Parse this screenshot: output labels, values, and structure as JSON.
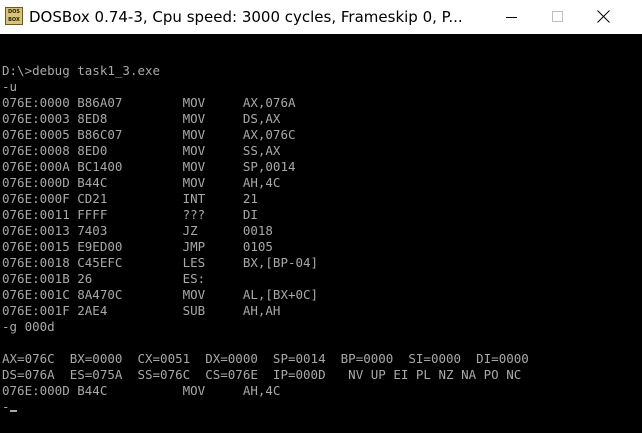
{
  "window": {
    "title": "DOSBox 0.74-3, Cpu speed:      3000 cycles, Frameskip  0, P...",
    "icon_text_top": "DOS",
    "icon_text_bottom": "BOX"
  },
  "controls": {
    "minimize": "minimize",
    "maximize": "maximize",
    "close": "close"
  },
  "colors": {
    "console_background": "#000000",
    "console_text": "#a8a8a8",
    "titlebar_background": "#ffffff"
  },
  "console": {
    "lines": [
      "",
      "D:\\>debug task1_3.exe",
      "-u",
      "076E:0000 B86A07        MOV     AX,076A",
      "076E:0003 8ED8          MOV     DS,AX",
      "076E:0005 B86C07        MOV     AX,076C",
      "076E:0008 8ED0          MOV     SS,AX",
      "076E:000A BC1400        MOV     SP,0014",
      "076E:000D B44C          MOV     AH,4C",
      "076E:000F CD21          INT     21",
      "076E:0011 FFFF          ???     DI",
      "076E:0013 7403          JZ      0018",
      "076E:0015 E9ED00        JMP     0105",
      "076E:0018 C45EFC        LES     BX,[BP-04]",
      "076E:001B 26            ES:",
      "076E:001C 8A470C        MOV     AL,[BX+0C]",
      "076E:001F 2AE4          SUB     AH,AH",
      "-g 000d",
      "",
      "AX=076C  BX=0000  CX=0051  DX=0000  SP=0014  BP=0000  SI=0000  DI=0000",
      "DS=076A  ES=075A  SS=076C  CS=076E  IP=000D   NV UP EI PL NZ NA PO NC",
      "076E:000D B44C          MOV     AH,4C"
    ],
    "prompt": "-"
  }
}
